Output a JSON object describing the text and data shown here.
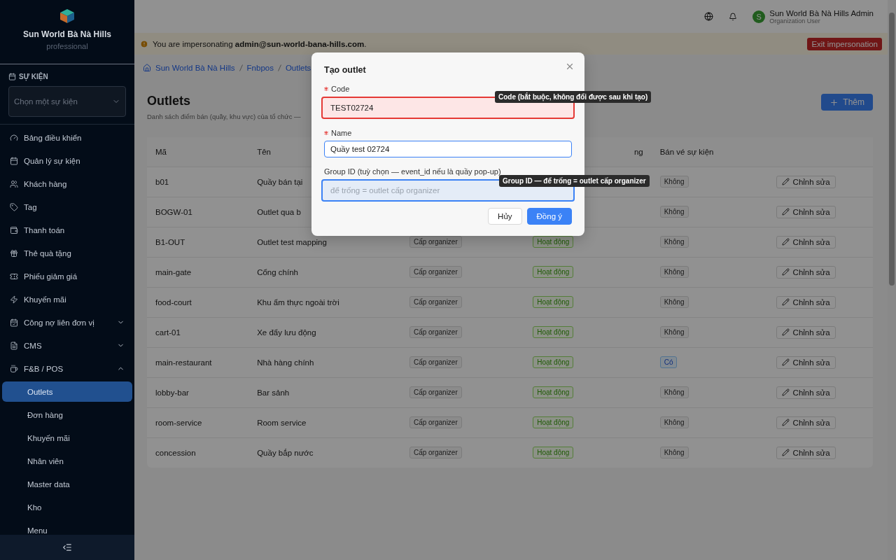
{
  "sidebar": {
    "org_name": "Sun World Bà Nà Hills",
    "plan": "professional",
    "event_section": {
      "label": "SỰ KIỆN",
      "select_placeholder": "Chọn một sự kiện"
    },
    "items": [
      {
        "label": "Bảng điều khiển"
      },
      {
        "label": "Quản lý sự kiện"
      },
      {
        "label": "Khách hàng"
      },
      {
        "label": "Tag"
      },
      {
        "label": "Thanh toán"
      },
      {
        "label": "Thẻ quà tặng"
      },
      {
        "label": "Phiếu giảm giá"
      },
      {
        "label": "Khuyến mãi"
      },
      {
        "label": "Công nợ liên đơn vị",
        "expanded": false
      },
      {
        "label": "CMS",
        "expanded": false
      },
      {
        "label": "F&B / POS",
        "expanded": true,
        "children": [
          {
            "label": "Outlets",
            "selected": true
          },
          {
            "label": "Đơn hàng",
            "selected": false
          },
          {
            "label": "Khuyến mãi",
            "selected": false
          },
          {
            "label": "Nhân viên",
            "selected": false
          },
          {
            "label": "Master data",
            "selected": false
          },
          {
            "label": "Kho",
            "selected": false
          },
          {
            "label": "Menu",
            "selected": false
          }
        ]
      }
    ]
  },
  "topbar": {
    "avatar_letter": "S",
    "user_name": "Sun World Bà Nà Hills Admin",
    "user_role": "Organization User"
  },
  "banner": {
    "text": "You are impersonating **admin@sun-world-bana-hills.com**.",
    "button": "Exit impersonation"
  },
  "breadcrumb": [
    "Sun World Bà Nà Hills",
    "Fnbpos",
    "Outlets"
  ],
  "page": {
    "title": "Outlets",
    "subtitle": "Danh sách điểm bán (quầy, khu vực) của tổ chức —",
    "add_button": "Thêm"
  },
  "table": {
    "columns": [
      {
        "label": "Mã"
      },
      {
        "label": "Tên"
      },
      {},
      {
        "label": "ng"
      },
      {
        "label": "Bán vé sự kiện"
      },
      {}
    ],
    "rows": [
      {
        "code": "b01",
        "name": "Quầy bán tại",
        "ticket": {
          "text": "Không",
          "on": false
        },
        "action": "Chỉnh sửa"
      },
      {
        "code": "BOGW-01",
        "name": "Outlet qua b",
        "ticket": {
          "text": "Không",
          "on": false
        },
        "action": "Chỉnh sửa"
      },
      {
        "code": "B1-OUT",
        "name": "Outlet test mapping",
        "scope": "Cấp organizer",
        "status": {
          "text": "Hoạt động",
          "active": true
        },
        "ticket": {
          "text": "Không",
          "on": false
        },
        "action": "Chỉnh sửa"
      },
      {
        "code": "main-gate",
        "name": "Cổng chính",
        "scope": "Cấp organizer",
        "status": {
          "text": "Hoạt động",
          "active": true
        },
        "ticket": {
          "text": "Không",
          "on": false
        },
        "action": "Chỉnh sửa"
      },
      {
        "code": "food-court",
        "name": "Khu ẩm thực ngoài trời",
        "scope": "Cấp organizer",
        "status": {
          "text": "Hoạt động",
          "active": true
        },
        "ticket": {
          "text": "Không",
          "on": false
        },
        "action": "Chỉnh sửa"
      },
      {
        "code": "cart-01",
        "name": "Xe đẩy lưu động",
        "scope": "Cấp organizer",
        "status": {
          "text": "Hoạt động",
          "active": true
        },
        "ticket": {
          "text": "Không",
          "on": false
        },
        "action": "Chỉnh sửa"
      },
      {
        "code": "main-restaurant",
        "name": "Nhà hàng chính",
        "scope": "Cấp organizer",
        "status": {
          "text": "Hoạt động",
          "active": true
        },
        "ticket": {
          "text": "Có",
          "on": true
        },
        "action": "Chỉnh sửa"
      },
      {
        "code": "lobby-bar",
        "name": "Bar sảnh",
        "scope": "Cấp organizer",
        "status": {
          "text": "Hoạt động",
          "active": true
        },
        "ticket": {
          "text": "Không",
          "on": false
        },
        "action": "Chỉnh sửa"
      },
      {
        "code": "room-service",
        "name": "Room service",
        "scope": "Cấp organizer",
        "status": {
          "text": "Hoạt động",
          "active": true
        },
        "ticket": {
          "text": "Không",
          "on": false
        },
        "action": "Chỉnh sửa"
      },
      {
        "code": "concession",
        "name": "Quầy bắp nước",
        "scope": "Cấp organizer",
        "status": {
          "text": "Hoạt động",
          "active": true
        },
        "ticket": {
          "text": "Không",
          "on": false
        },
        "action": "Chỉnh sửa"
      }
    ]
  },
  "dialog": {
    "title": "Tạo outlet",
    "fields": [
      {
        "label": "Code",
        "required": true,
        "value": "TEST02724",
        "invalid": true,
        "focused": false,
        "tooltip": "Code (bắt buộc, không đổi được sau khi tạo)"
      },
      {
        "label": "Name",
        "required": true,
        "value": "Quầy test 02724",
        "invalid": false,
        "focused": true
      },
      {
        "label": "Group ID (tuỳ chọn — event_id nếu là quầy pop-up)",
        "required": false,
        "placeholder": "để trống = outlet cấp organizer",
        "invalid": false,
        "focused": false,
        "hovered": true,
        "tooltip": "Group ID — để trống = outlet cấp organizer"
      }
    ],
    "cancel": "Hủy",
    "ok": "Đồng ý"
  }
}
